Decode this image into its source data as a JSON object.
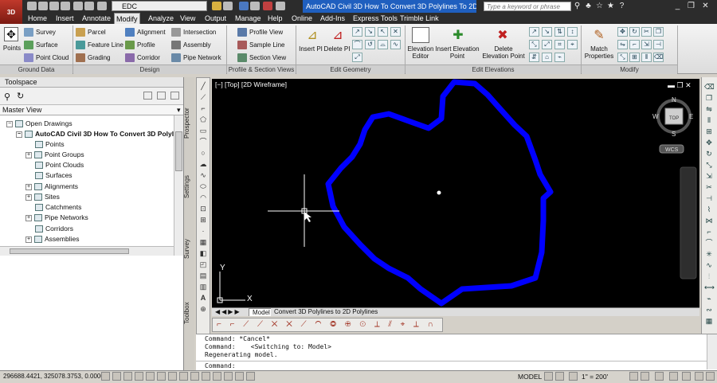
{
  "title": {
    "workspace": "EDC",
    "window_title": "AutoCAD Civil 3D How To Convert 3D Polylines To 2D Polyli...",
    "search_placeholder": "Type a keyword or phrase",
    "app_version": "3D"
  },
  "menu": [
    "Home",
    "Insert",
    "Annotate",
    "Modify",
    "Analyze",
    "View",
    "Output",
    "Manage",
    "Help",
    "Online",
    "Add-Ins",
    "Express Tools",
    "Trimble Link"
  ],
  "active_menu": "Modify",
  "ribbon": {
    "ground_data": {
      "title": "Ground Data",
      "points": "Points",
      "items": [
        "Survey",
        "Surface",
        "Point Cloud"
      ]
    },
    "design": {
      "title": "Design",
      "col1": [
        "Parcel",
        "Feature Line",
        "Grading"
      ],
      "col2": [
        "Alignment",
        "Profile",
        "Corridor"
      ],
      "col3": [
        "Intersection",
        "Assembly",
        "Pipe Network"
      ]
    },
    "profile_section": {
      "title": "Profile & Section Views",
      "items": [
        "Profile View",
        "Sample Line",
        "Section View"
      ]
    },
    "edit_geometry": {
      "title": "Edit Geometry",
      "insert_pi": "Insert PI",
      "delete_pi": "Delete PI"
    },
    "edit_elevations": {
      "title": "Edit Elevations",
      "elevation_editor": "Elevation Editor",
      "insert_point": "Insert Elevation Point",
      "delete_point": "Delete Elevation Point"
    },
    "modify": {
      "title": "Modify",
      "match_properties": "Match Properties"
    }
  },
  "toolspace": {
    "title": "Toolspace",
    "view": "Master View",
    "tree": [
      {
        "label": "Open Drawings",
        "level": 0,
        "expander": "−"
      },
      {
        "label": "AutoCAD Civil 3D How To Convert 3D Polylin...",
        "level": 1,
        "expander": "−",
        "bold": true
      },
      {
        "label": "Points",
        "level": 2,
        "expander": ""
      },
      {
        "label": "Point Groups",
        "level": 2,
        "expander": "+"
      },
      {
        "label": "Point Clouds",
        "level": 2,
        "expander": ""
      },
      {
        "label": "Surfaces",
        "level": 2,
        "expander": ""
      },
      {
        "label": "Alignments",
        "level": 2,
        "expander": "+"
      },
      {
        "label": "Sites",
        "level": 2,
        "expander": "+"
      },
      {
        "label": "Catchments",
        "level": 2,
        "expander": ""
      },
      {
        "label": "Pipe Networks",
        "level": 2,
        "expander": "+"
      },
      {
        "label": "Corridors",
        "level": 2,
        "expander": ""
      },
      {
        "label": "Assemblies",
        "level": 2,
        "expander": "+"
      }
    ],
    "side_tabs": [
      "Prospector",
      "Settings",
      "Survey",
      "Toolbox"
    ]
  },
  "viewport": {
    "label": "[−] [Top] [2D Wireframe]",
    "compass": {
      "n": "N",
      "s": "S",
      "e": "E",
      "w": "W",
      "top": "TOP",
      "wcs": "WCS"
    },
    "axis_x": "X",
    "axis_y": "Y",
    "polyline_color": "#0000ff"
  },
  "layout_tabs": {
    "model": "Model",
    "layout": "Convert 3D Polylines to 2D Polylines"
  },
  "command": {
    "lines": [
      "Command: *Cancel*",
      "Command:    <Switching to: Model>",
      "Regenerating model."
    ],
    "prompt": "Command:"
  },
  "status": {
    "coords": "296688.4421, 325078.3753, 0.0000",
    "model": "MODEL",
    "scale": "1\" = 200'"
  }
}
